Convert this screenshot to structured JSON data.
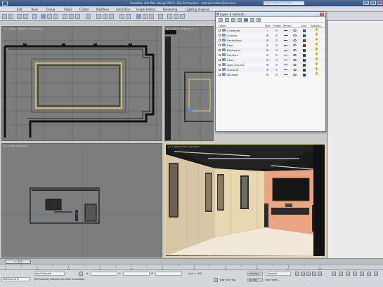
{
  "window": {
    "title": "Autodesk 3ds Max Design 2010 - file:///c/mydocs - interior-scene-Start.max",
    "search_placeholder": "Type a keyword or phrase"
  },
  "menu": [
    "Edit",
    "Tools",
    "Group",
    "Views",
    "Create",
    "Modifiers",
    "Animation",
    "Graph Editors",
    "Rendering",
    "Lighting Analysis"
  ],
  "viewports": {
    "top": "[ + ] [ Top ] [ Shaded + Edged Faces ]",
    "front": "[ + ] [ Front ] [ Shaded ]",
    "left": "[ + ] [ Left ] [ Shaded ]",
    "perspective": "[ + ] [ Perspective ] [ Shaded ]"
  },
  "layer_dialog": {
    "title": "Layer: 0 (default)",
    "columns": [
      "Layers",
      "Hide",
      "Freeze",
      "Render",
      "Color",
      "Radiosity"
    ],
    "layers": [
      {
        "name": "0 (default)",
        "color": "#2f6fb0",
        "current": true
      },
      {
        "name": "Curtains",
        "color": "#2f8a6e"
      },
      {
        "name": "Decorations",
        "color": "#7a2d8a"
      },
      {
        "name": "Door",
        "color": "#8a2d4a"
      },
      {
        "name": "Electronics",
        "color": "#2d3f9a"
      },
      {
        "name": "Furniture",
        "color": "#23307a"
      },
      {
        "name": "Glass",
        "color": "#3e3e9a"
      },
      {
        "name": "Light_Fixtures",
        "color": "#1f6f7a"
      },
      {
        "name": "Structure",
        "color": "#8a1f1f"
      },
      {
        "name": "Windows",
        "color": "#1f2f8a"
      }
    ]
  },
  "timeline": {
    "frame": "0 / 100",
    "ticks": [
      "0",
      "10",
      "20",
      "30",
      "40",
      "50",
      "60",
      "70",
      "80",
      "90",
      "100"
    ]
  },
  "status": {
    "selection": "None Selected",
    "message": "The Radiosity Solution has been Invalidated",
    "welcome": "Welcome to M",
    "x_label": "X:",
    "y_label": "Y:",
    "z_label": "Z:",
    "grid": "Grid = 10.0",
    "add_time_tag": "Add Time Tag",
    "auto_key": "Auto Key",
    "selected": "Selected",
    "set_key": "Set Key",
    "key_filters": "Key Filters..."
  }
}
